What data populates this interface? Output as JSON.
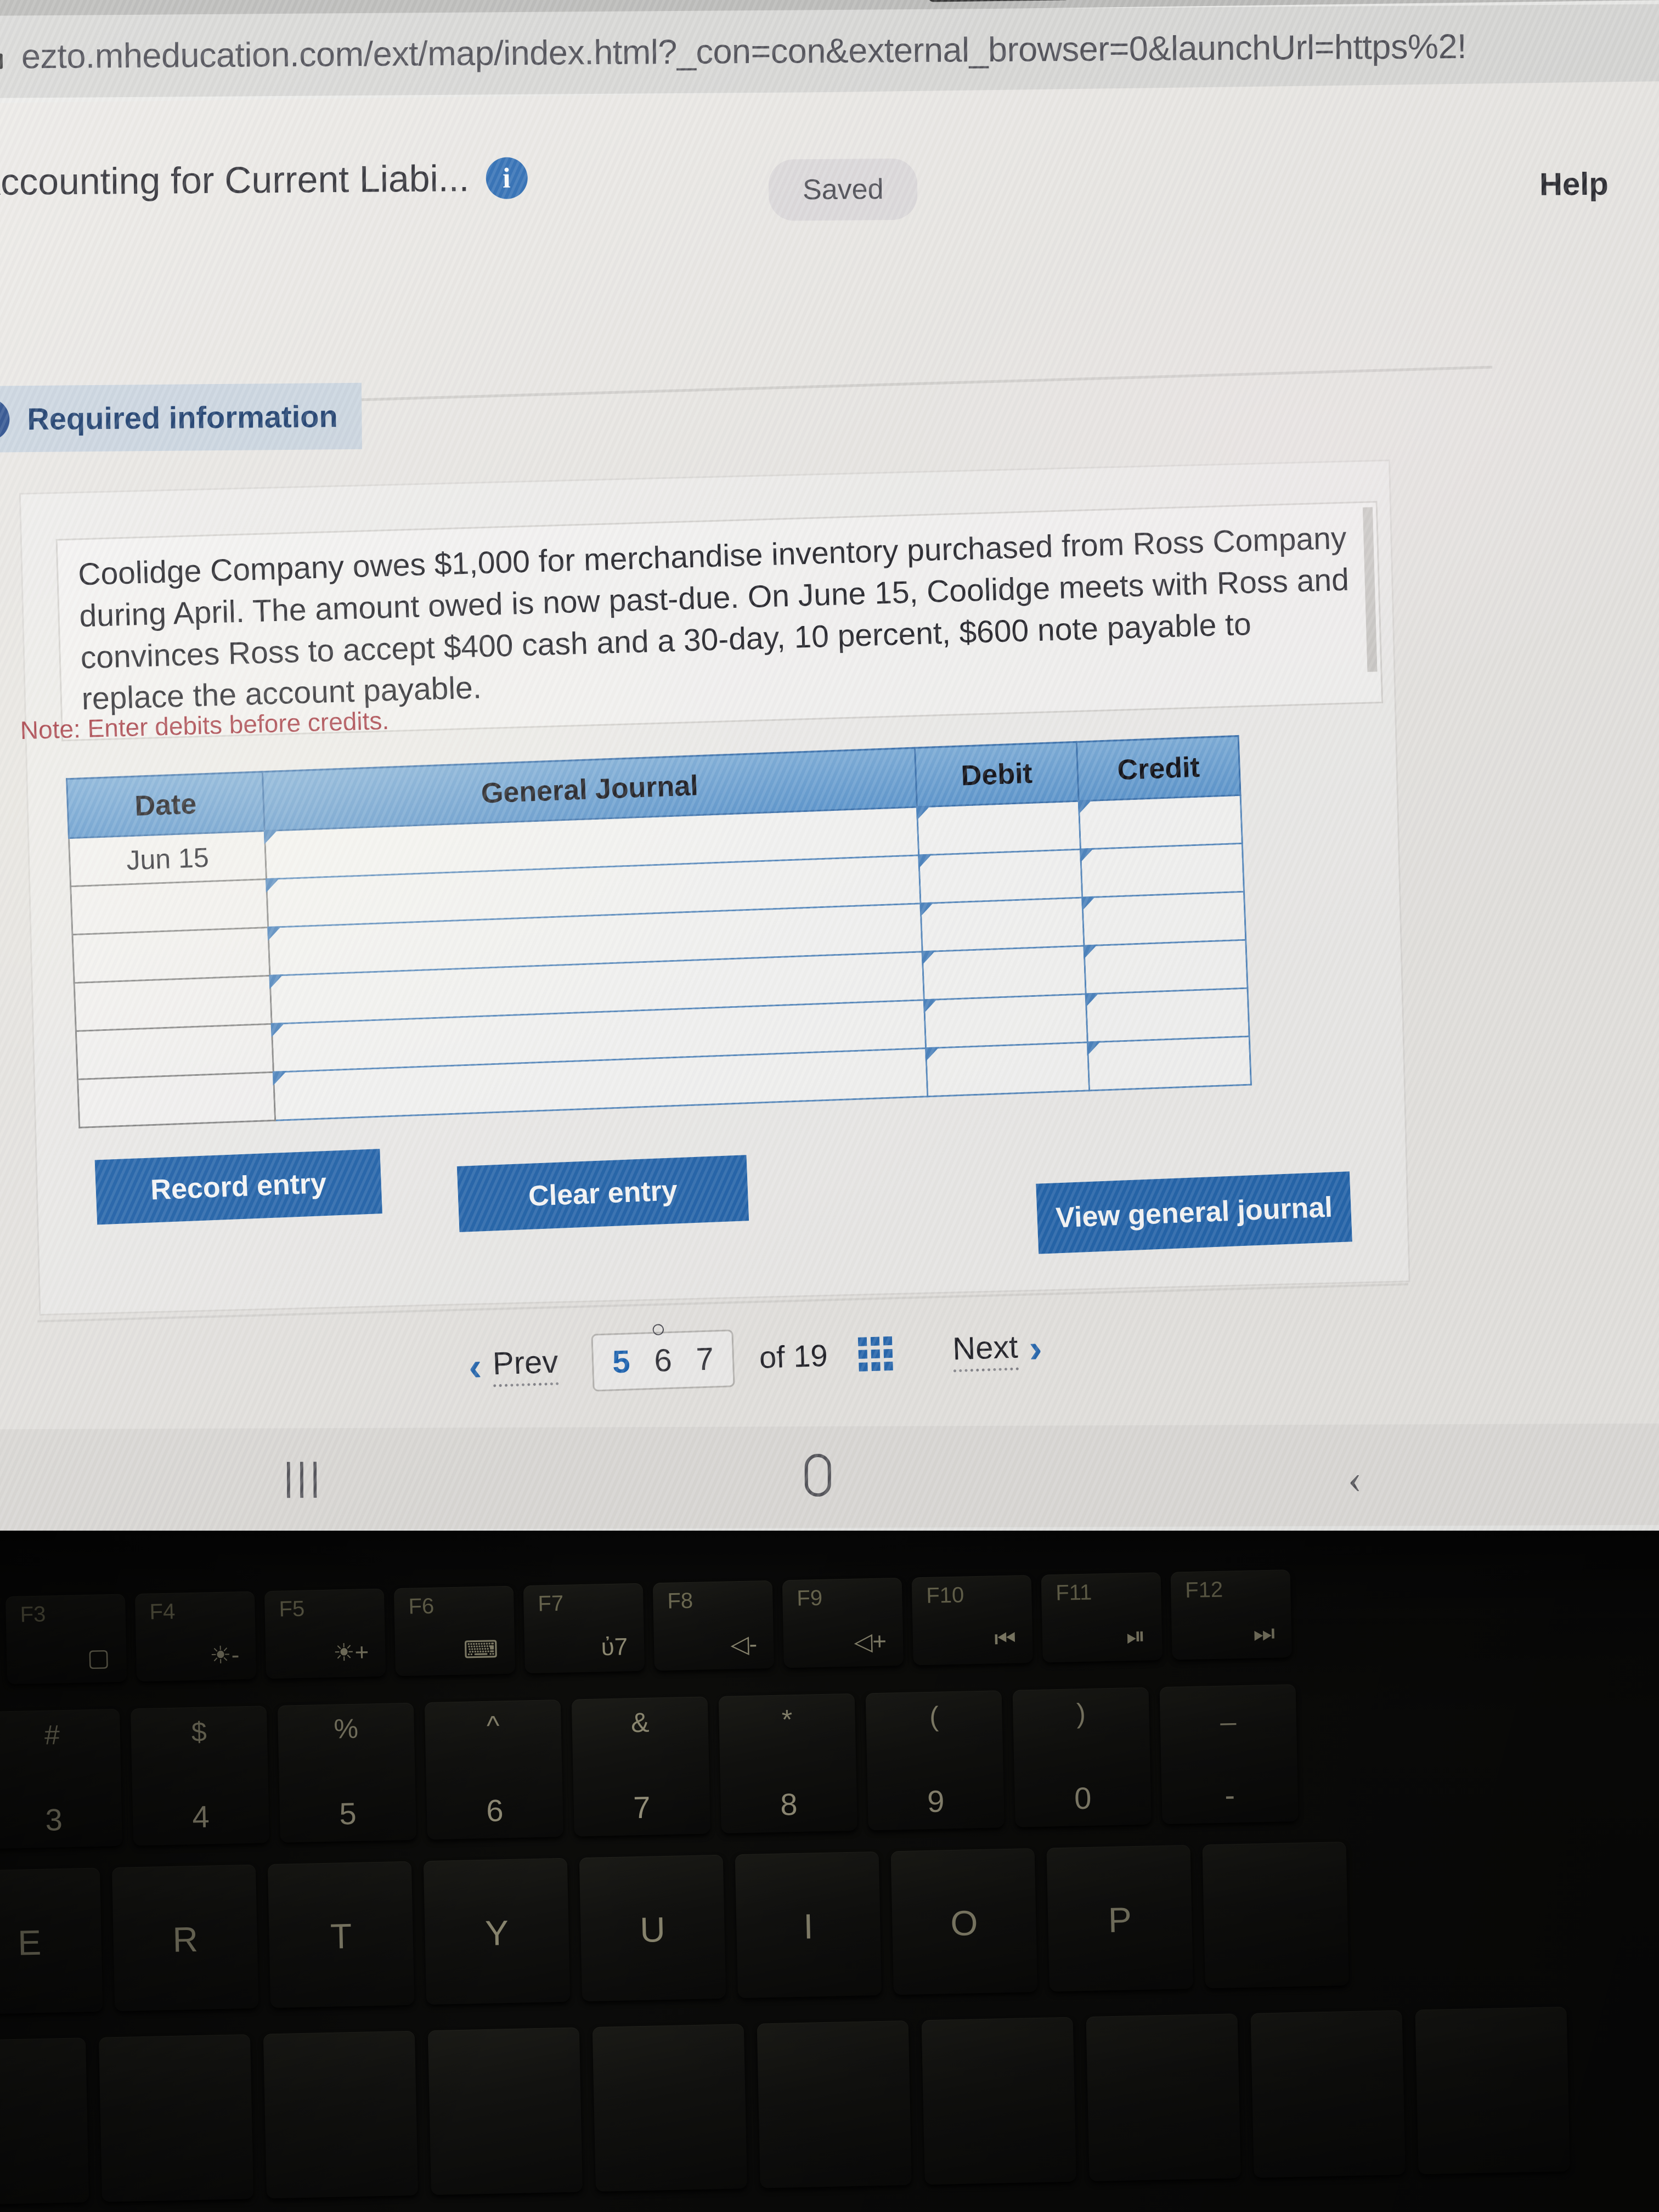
{
  "browser": {
    "url": "ezto.mheducation.com/ext/map/index.html?_con=con&external_browser=0&launchUrl=https%2!",
    "lock_icon": "lock-icon"
  },
  "assignment": {
    "title": "Accounting for Current Liabi...",
    "info_icon": "info-icon",
    "saved_status": "Saved",
    "help_label": "Help"
  },
  "banner": {
    "exclamation": "!",
    "label": "Required information"
  },
  "problem": {
    "text": "Coolidge Company owes $1,000 for merchandise inventory purchased from Ross Company during April. The amount owed is now past-due. On June 15, Coolidge meets with Ross and convinces Ross to accept $400 cash and a 30-day, 10 percent, $600 note payable to replace the account payable.",
    "note": "Note: Enter debits before credits."
  },
  "journal": {
    "headers": [
      "Date",
      "General Journal",
      "Debit",
      "Credit"
    ],
    "rows": [
      {
        "date": "Jun 15",
        "account": "",
        "debit": "",
        "credit": ""
      },
      {
        "date": "",
        "account": "",
        "debit": "",
        "credit": ""
      },
      {
        "date": "",
        "account": "",
        "debit": "",
        "credit": ""
      },
      {
        "date": "",
        "account": "",
        "debit": "",
        "credit": ""
      },
      {
        "date": "",
        "account": "",
        "debit": "",
        "credit": ""
      },
      {
        "date": "",
        "account": "",
        "debit": "",
        "credit": ""
      }
    ]
  },
  "actions": {
    "record": "Record entry",
    "clear": "Clear entry",
    "view": "View general journal"
  },
  "pagination": {
    "prev": "Prev",
    "next": "Next",
    "pages": [
      "5",
      "6",
      "7"
    ],
    "active_page": "5",
    "spinner_glyph": "○",
    "of_label": "of 19",
    "grid_icon": "grid-icon"
  },
  "android_nav": {
    "recents": "|||",
    "home": "home-icon",
    "back": "‹"
  },
  "colors": {
    "accent_blue": "#2769b1",
    "header_blue": "#5f9ad3",
    "note_red": "#a83a44",
    "banner_blue": "#1b3d6e"
  },
  "keyboard": {
    "fn_row": [
      {
        "fn": "F3",
        "glyph": "▢"
      },
      {
        "fn": "F4",
        "glyph": "☀-"
      },
      {
        "fn": "F5",
        "glyph": "☀+"
      },
      {
        "fn": "F6",
        "glyph": "⌨"
      },
      {
        "fn": "F7",
        "glyph": "ὐ7"
      },
      {
        "fn": "F8",
        "glyph": "◁-"
      },
      {
        "fn": "F9",
        "glyph": "◁+"
      },
      {
        "fn": "F10",
        "glyph": "⏮"
      },
      {
        "fn": "F11",
        "glyph": "⏯"
      },
      {
        "fn": "F12",
        "glyph": "⏭"
      }
    ],
    "number_row": [
      {
        "upper": "#",
        "lower": "3"
      },
      {
        "upper": "$",
        "lower": "4"
      },
      {
        "upper": "%",
        "lower": "5"
      },
      {
        "upper": "^",
        "lower": "6"
      },
      {
        "upper": "&",
        "lower": "7"
      },
      {
        "upper": "*",
        "lower": "8"
      },
      {
        "upper": "(",
        "lower": "9"
      },
      {
        "upper": ")",
        "lower": "0"
      },
      {
        "upper": "_",
        "lower": "-"
      }
    ],
    "letter_row": [
      "E",
      "R",
      "T",
      "Y",
      "U",
      "I",
      "O",
      "P"
    ]
  }
}
